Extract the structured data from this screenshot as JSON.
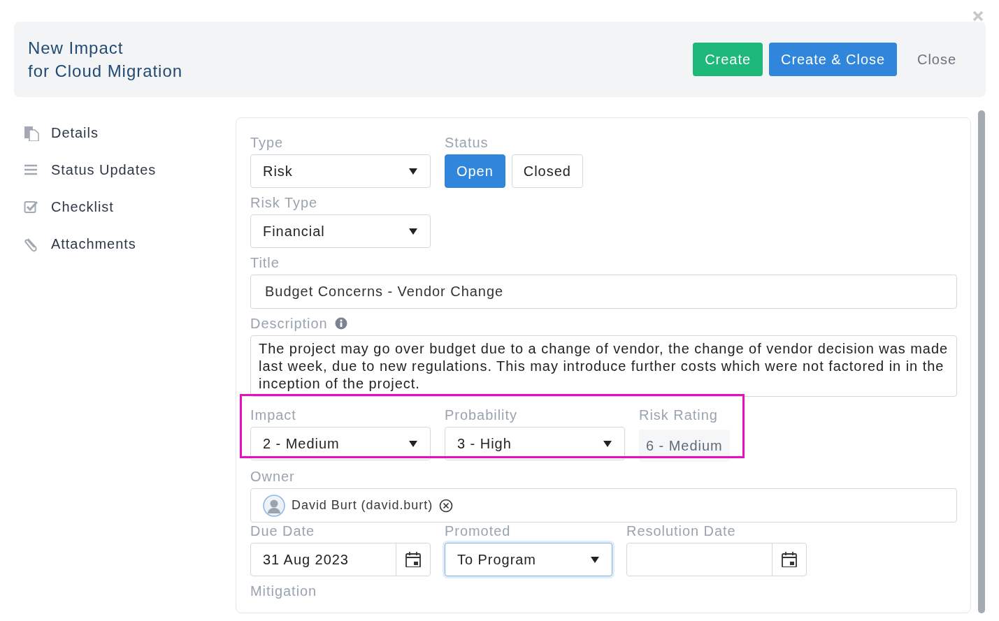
{
  "header": {
    "title_lines": [
      "New Impact",
      "for Cloud Migration"
    ],
    "buttons": [
      {
        "label": "Create",
        "kind": "success"
      },
      {
        "label": "Create & Close",
        "kind": "primary"
      },
      {
        "label": "Close",
        "kind": "plain"
      }
    ]
  },
  "sidebar": {
    "items": [
      {
        "label": "Details"
      },
      {
        "label": "Status Updates"
      },
      {
        "label": "Checklist"
      },
      {
        "label": "Attachments"
      }
    ]
  },
  "form": {
    "type": {
      "label": "Type",
      "value": "Risk"
    },
    "status": {
      "label": "Status",
      "options": [
        {
          "label": "Open",
          "selected": true
        },
        {
          "label": "Closed",
          "selected": false
        }
      ]
    },
    "risk_type": {
      "label": "Risk Type",
      "value": "Financial"
    },
    "title": {
      "label": "Title",
      "value": "Budget Concerns - Vendor Change"
    },
    "description": {
      "label": "Description",
      "value": "The project may go over budget due to a change of vendor, the change of vendor decision was made last week, due to new regulations. This may introduce further costs which were not factored in in the inception of the project."
    },
    "rating_row": {
      "highlighted": true,
      "impact": {
        "label": "Impact",
        "value": "2 - Medium"
      },
      "probability": {
        "label": "Probability",
        "value": "3 - High"
      },
      "risk_rating": {
        "label": "Risk Rating",
        "value": "6 - Medium"
      }
    },
    "owner": {
      "label": "Owner",
      "value": "David Burt (david.burt)"
    },
    "due_date": {
      "label": "Due Date",
      "value": "31 Aug 2023"
    },
    "promoted": {
      "label": "Promoted",
      "value": "To Program",
      "focused": true
    },
    "resolution_date": {
      "label": "Resolution Date"
    },
    "mitigation": {
      "label": "Mitigation"
    }
  }
}
